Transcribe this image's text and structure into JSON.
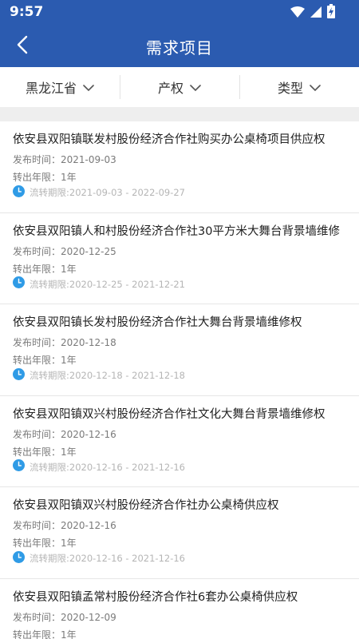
{
  "status": {
    "time": "9:57",
    "icons": [
      "wifi-icon",
      "signal-icon",
      "battery-charging-icon"
    ]
  },
  "header": {
    "title": "需求项目",
    "back_icon": "back-arrow-icon"
  },
  "filters": [
    {
      "label": "黑龙江省",
      "icon": "chevron-down-icon"
    },
    {
      "label": "产权",
      "icon": "chevron-down-icon"
    },
    {
      "label": "类型",
      "icon": "chevron-down-icon"
    }
  ],
  "labels": {
    "publish": "发布时间:",
    "years": "转出年限:",
    "period": "流转期限:"
  },
  "items": [
    {
      "title": "依安县双阳镇联发村股份经济合作社购买办公桌椅项目供应权",
      "publish_time": "发布时间：2021-09-03",
      "years": "转出年限：1年",
      "period": "流转期限:2021-09-03 - 2022-09-27"
    },
    {
      "title": "依安县双阳镇人和村股份经济合作社30平方米大舞台背景墙维修",
      "publish_time": "发布时间：2020-12-25",
      "years": "转出年限：1年",
      "period": "流转期限:2020-12-25 - 2021-12-21"
    },
    {
      "title": "依安县双阳镇长发村股份经济合作社大舞台背景墙维修权",
      "publish_time": "发布时间：2020-12-18",
      "years": "转出年限：1年",
      "period": "流转期限:2020-12-18 - 2021-12-18"
    },
    {
      "title": "依安县双阳镇双兴村股份经济合作社文化大舞台背景墙维修权",
      "publish_time": "发布时间：2020-12-16",
      "years": "转出年限：1年",
      "period": "流转期限:2020-12-16 - 2021-12-16"
    },
    {
      "title": "依安县双阳镇双兴村股份经济合作社办公桌椅供应权",
      "publish_time": "发布时间：2020-12-16",
      "years": "转出年限：1年",
      "period": "流转期限:2020-12-16 - 2021-12-16"
    },
    {
      "title": "依安县双阳镇孟常村股份经济合作社6套办公桌椅供应权",
      "publish_time": "发布时间：2020-12-09",
      "years": "转出年限：1年",
      "period": ""
    }
  ],
  "colors": {
    "primary": "#2b5bb0",
    "clock": "#2f9be6",
    "muted": "#b5b5b5"
  }
}
